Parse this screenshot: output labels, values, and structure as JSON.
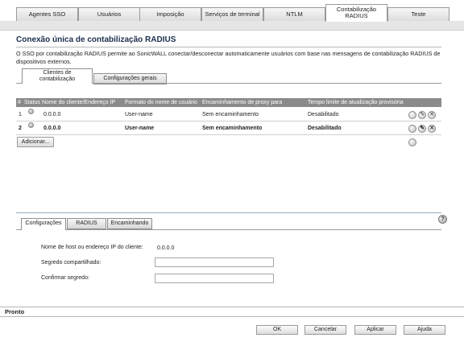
{
  "top_tabs": [
    {
      "label": "Agentes SSO"
    },
    {
      "label": "Usuários"
    },
    {
      "label": "Imposição"
    },
    {
      "label": "Serviços de terminal"
    },
    {
      "label": "NTLM"
    },
    {
      "label_line1": "Contabilização",
      "label_line2": "RADIUS"
    },
    {
      "label": "Teste"
    }
  ],
  "section": {
    "title": "Conexão única de contabilização RADIUS",
    "description": "O SSO por contabilização RADIUS permite ao SonicWALL conectar/desconectar automaticamente usuários com base nas mensagens de contabilização RADIUS de dispositivos externos."
  },
  "sub_tabs": [
    {
      "label_line1": "Clientes de",
      "label_line2": "contabilização"
    },
    {
      "label": "Configurações gerais"
    }
  ],
  "table": {
    "headers": [
      "#",
      "Status",
      "Nome do cliente/Endereço IP",
      "Formato do nome de usuário",
      "Encaminhamento de proxy para",
      "Tempo limite de atualização provisória"
    ],
    "rows": [
      {
        "num": "1",
        "ip": "0.0.0.0",
        "format": "User-name",
        "forward": "Sem encaminhamento",
        "timeout": "Desabilitado"
      },
      {
        "num": "2",
        "ip": "0.0.0.0",
        "format": "User-name",
        "forward": "Sem encaminhamento",
        "timeout": "Desabilitado"
      }
    ],
    "add_button": "Adicionar..."
  },
  "lower_tabs": [
    "Configurações",
    "RADIUS",
    "Encaminhando"
  ],
  "form": {
    "host_label": "Nome de host ou endereço IP do cliente:",
    "host_value": "0.0.0.0",
    "secret_label": "Segredo compartilhado:",
    "confirm_label": "Confirmar segredo:"
  },
  "status_text": "Pronto",
  "footer_buttons": {
    "ok": "OK",
    "cancel": "Cancelar",
    "apply": "Aplicar",
    "help": "Ajuda"
  },
  "icons": {
    "status": "status-dot-icon",
    "info": "info-icon",
    "edit": "pencil-icon",
    "delete": "delete-icon",
    "help": "help-icon"
  }
}
